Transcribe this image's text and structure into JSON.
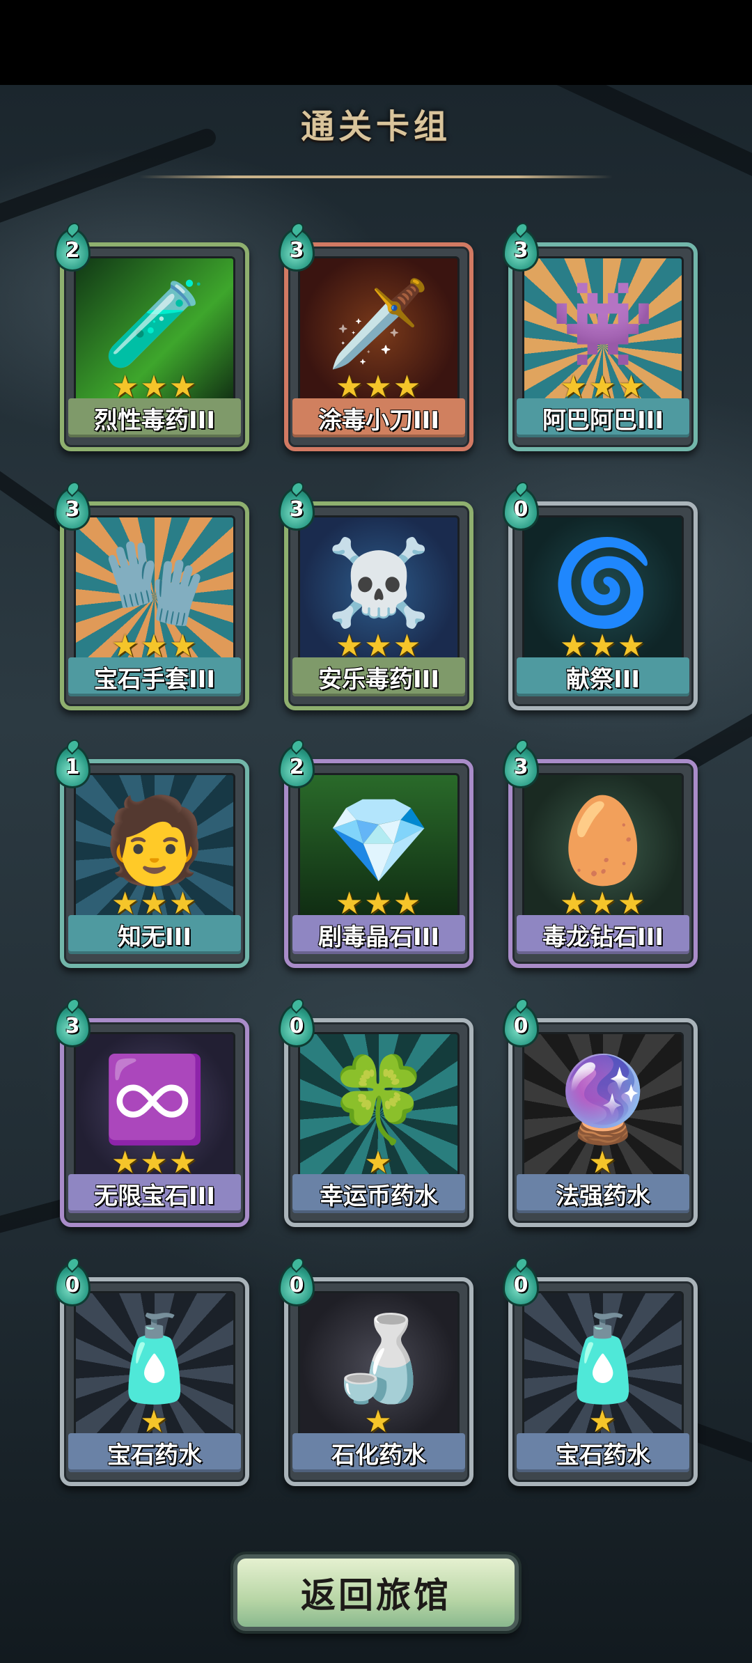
{
  "title": "通关卡组",
  "cards": [
    {
      "name": "烈性毒药III",
      "cost": "2",
      "stars": "★★★",
      "frame": "green",
      "plate": "#7f9a6a",
      "bg": "linear-gradient(135deg,#103515,#3ea62c 60%,#0f2a12)",
      "motif": "🧪",
      "icon": "poison-arm-icon"
    },
    {
      "name": "涂毒小刀III",
      "cost": "3",
      "stars": "★★★",
      "frame": "orange",
      "plate": "#d0805f",
      "bg": "radial-gradient(circle,#7a3a1a,#3a1410 70%)",
      "motif": "🗡️",
      "icon": "poison-dagger-icon"
    },
    {
      "name": "阿巴阿巴III",
      "cost": "3",
      "stars": "★★★",
      "frame": "teal",
      "plate": "#4f9aa0",
      "bg": "repeating-conic-gradient(from 0deg at 50% 60%,#e0a45e 0 12deg,#2a7e88 12deg 24deg)",
      "motif": "👾",
      "icon": "shadow-creature-icon"
    },
    {
      "name": "宝石手套III",
      "cost": "3",
      "stars": "★★★",
      "frame": "green",
      "plate": "#4f9aa0",
      "bg": "repeating-conic-gradient(from 0deg at 50% 55%,#e09a58 0 12deg,#2a7e88 12deg 24deg)",
      "motif": "🧤",
      "icon": "gem-gauntlet-icon"
    },
    {
      "name": "安乐毒药III",
      "cost": "3",
      "stars": "★★★",
      "frame": "green",
      "plate": "#7f9a6a",
      "bg": "radial-gradient(circle,#2d5b8a,#1a2b4e 70%)",
      "motif": "☠️",
      "icon": "poison-flask-icon"
    },
    {
      "name": "献祭III",
      "cost": "0",
      "stars": "★★★",
      "frame": "silver",
      "plate": "#4f9aa0",
      "bg": "radial-gradient(circle,#1f4a4f,#0f2527 70%)",
      "motif": "🌀",
      "icon": "sacrifice-icon"
    },
    {
      "name": "知无III",
      "cost": "1",
      "stars": "★★★",
      "frame": "teal",
      "plate": "#4f9aa0",
      "bg": "repeating-conic-gradient(from 0deg at 50% 55%,#2f5f74 0 14deg,#173845 14deg 28deg)",
      "motif": "🧑",
      "icon": "hero-portrait-icon"
    },
    {
      "name": "剧毒晶石III",
      "cost": "2",
      "stars": "★★★",
      "frame": "purple",
      "plate": "#8f86c2",
      "bg": "linear-gradient(#2a6b2a,#0f2a12)",
      "motif": "💎",
      "icon": "poison-crystal-icon"
    },
    {
      "name": "毒龙钻石III",
      "cost": "3",
      "stars": "★★★",
      "frame": "purple",
      "plate": "#8f86c2",
      "bg": "radial-gradient(circle,#3c5b4a,#1a2a22 70%)",
      "motif": "🥚",
      "icon": "dragon-diamond-icon"
    },
    {
      "name": "无限宝石III",
      "cost": "3",
      "stars": "★★★",
      "frame": "purple",
      "plate": "#8f86c2",
      "bg": "radial-gradient(circle,#4a4366,#221f33 70%)",
      "motif": "♾️",
      "icon": "infinity-gem-icon"
    },
    {
      "name": "幸运币药水",
      "cost": "0",
      "stars": "★",
      "frame": "silver",
      "plate": "#6a82a6",
      "bg": "repeating-conic-gradient(from 0deg at 50% 55%,#2a7e7e 0 14deg,#143c3c 14deg 28deg)",
      "motif": "🍀",
      "icon": "luck-potion-icon"
    },
    {
      "name": "法强药水",
      "cost": "0",
      "stars": "★",
      "frame": "silver",
      "plate": "#6a82a6",
      "bg": "repeating-conic-gradient(from 0deg at 50% 55%,#3a3a3a 0 14deg,#1a1a1a 14deg 28deg)",
      "motif": "🔮",
      "icon": "magic-potion-icon"
    },
    {
      "name": "宝石药水",
      "cost": "0",
      "stars": "★",
      "frame": "silver",
      "plate": "#6a82a6",
      "bg": "repeating-conic-gradient(from 0deg at 50% 55%,#3d4856 0 14deg,#1b2129 14deg 28deg)",
      "motif": "🧴",
      "icon": "gem-potion-icon"
    },
    {
      "name": "石化药水",
      "cost": "0",
      "stars": "★",
      "frame": "silver",
      "plate": "#6a82a6",
      "bg": "radial-gradient(circle,#4a4a55,#1f1f26 70%)",
      "motif": "🍶",
      "icon": "petrify-potion-icon"
    },
    {
      "name": "宝石药水",
      "cost": "0",
      "stars": "★",
      "frame": "silver",
      "plate": "#6a82a6",
      "bg": "repeating-conic-gradient(from 0deg at 50% 55%,#3d4856 0 14deg,#1b2129 14deg 28deg)",
      "motif": "🧴",
      "icon": "gem-potion-icon"
    }
  ],
  "back_button": {
    "label": "返回旅馆"
  }
}
